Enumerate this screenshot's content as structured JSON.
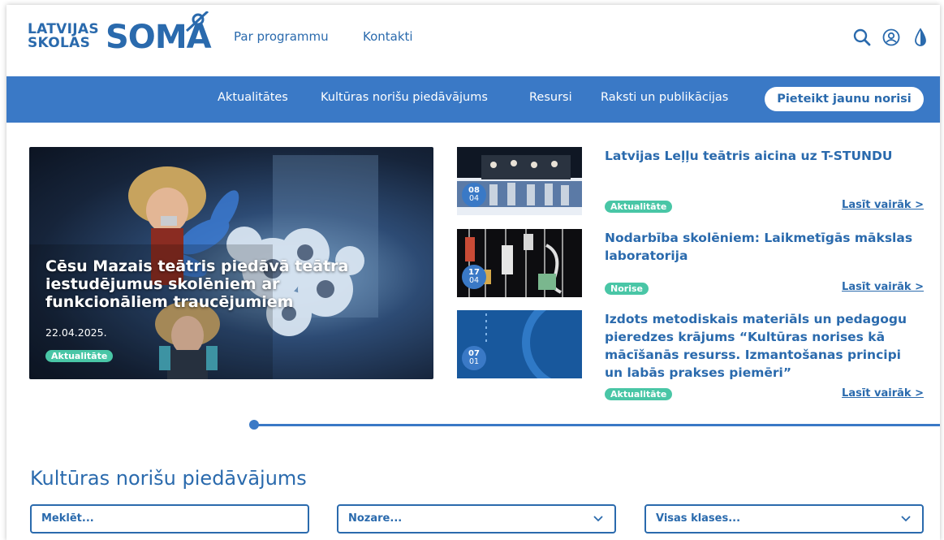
{
  "header": {
    "logo": {
      "small_line1": "LATVIJAS",
      "small_line2": "SKOLAS",
      "big": "SOMA"
    },
    "nav": [
      "Par programmu",
      "Kontakti"
    ],
    "tools": [
      "search-icon",
      "user-icon",
      "contrast-icon"
    ]
  },
  "menu": {
    "items": [
      "Aktualitātes",
      "Kultūras norišu piedāvājums",
      "Resursi",
      "Raksti un publikācijas"
    ],
    "cta": "Pieteikt jaunu norisi"
  },
  "hero": {
    "title": "Cēsu Mazais teātris piedāvā teātra iestudējumus skolēniem ar funkcionāliem traucējumiem",
    "date": "22.04.2025.",
    "badge": "Aktualitāte"
  },
  "news": [
    {
      "day": "08",
      "month": "04",
      "title": "Latvijas Leļļu teātris aicina uz T-STUNDU",
      "badge": "Aktualitāte",
      "read_more": "Lasīt vairāk >"
    },
    {
      "day": "17",
      "month": "04",
      "title": "Nodarbība skolēniem: Laikmetīgās mākslas laboratorija",
      "badge": "Norise",
      "read_more": "Lasīt vairāk >"
    },
    {
      "day": "07",
      "month": "01",
      "title": "Izdots metodiskais materiāls un pedagogu pieredzes krājums “Kultūras norises kā mācīšanās resurss. Izmantošanas principi un labās prakses piemēri”",
      "badge": "Aktualitāte",
      "read_more": "Lasīt vairāk >"
    }
  ],
  "offers": {
    "title": "Kultūras norišu piedāvājums",
    "search_placeholder": "Meklēt...",
    "field_selected": "Nozare...",
    "class_selected": "Visas klases..."
  },
  "colors": {
    "brand_blue": "#3a79c6",
    "text_blue": "#2a6aad",
    "badge_green": "#49c6a6"
  }
}
